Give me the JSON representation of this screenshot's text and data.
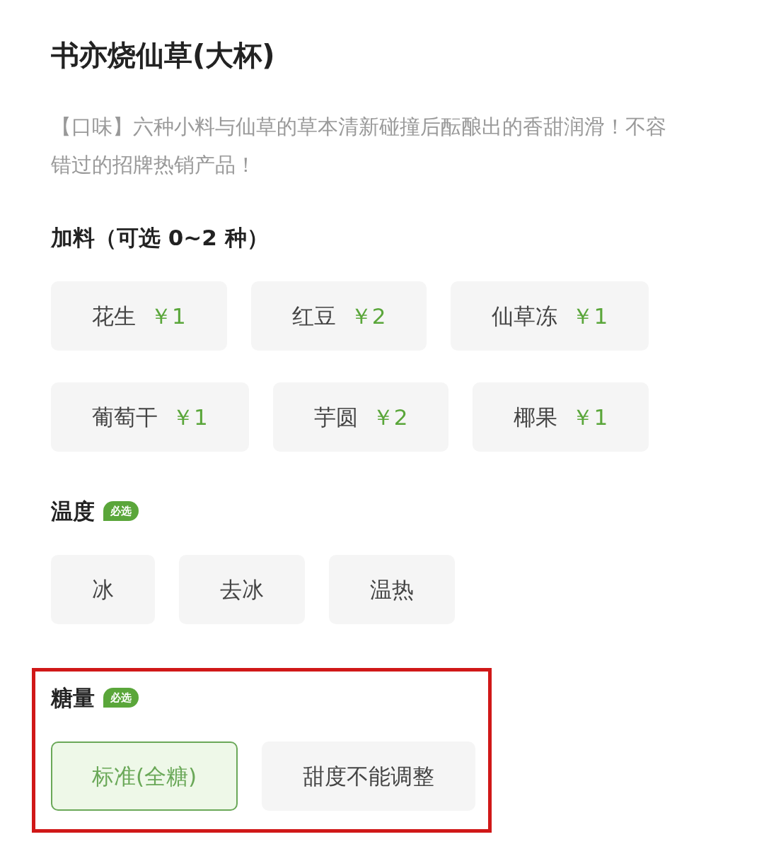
{
  "product": {
    "title": "书亦烧仙草(大杯)",
    "description": "【口味】六种小料与仙草的草本清新碰撞后酝酿出的香甜润滑！不容错过的招牌热销产品！"
  },
  "sections": [
    {
      "title": "加料（可选 0~2 种）",
      "highlighted": false,
      "options": [
        {
          "label": "花生",
          "price": "￥1",
          "selected": false
        },
        {
          "label": "红豆",
          "price": "￥2",
          "selected": false
        },
        {
          "label": "仙草冻",
          "price": "￥1",
          "selected": false
        },
        {
          "label": "葡萄干",
          "price": "￥1",
          "selected": false
        },
        {
          "label": "芋圆",
          "price": "￥2",
          "selected": false
        },
        {
          "label": "椰果",
          "price": "￥1",
          "selected": false
        }
      ]
    },
    {
      "title": "温度",
      "badge": "必选",
      "highlighted": false,
      "options": [
        {
          "label": "冰",
          "selected": false
        },
        {
          "label": "去冰",
          "selected": false
        },
        {
          "label": "温热",
          "selected": false
        }
      ]
    },
    {
      "title": "糖量",
      "badge": "必选",
      "highlighted": true,
      "options": [
        {
          "label": "标准(全糖)",
          "selected": true
        },
        {
          "label": "甜度不能调整",
          "selected": false
        }
      ]
    }
  ]
}
